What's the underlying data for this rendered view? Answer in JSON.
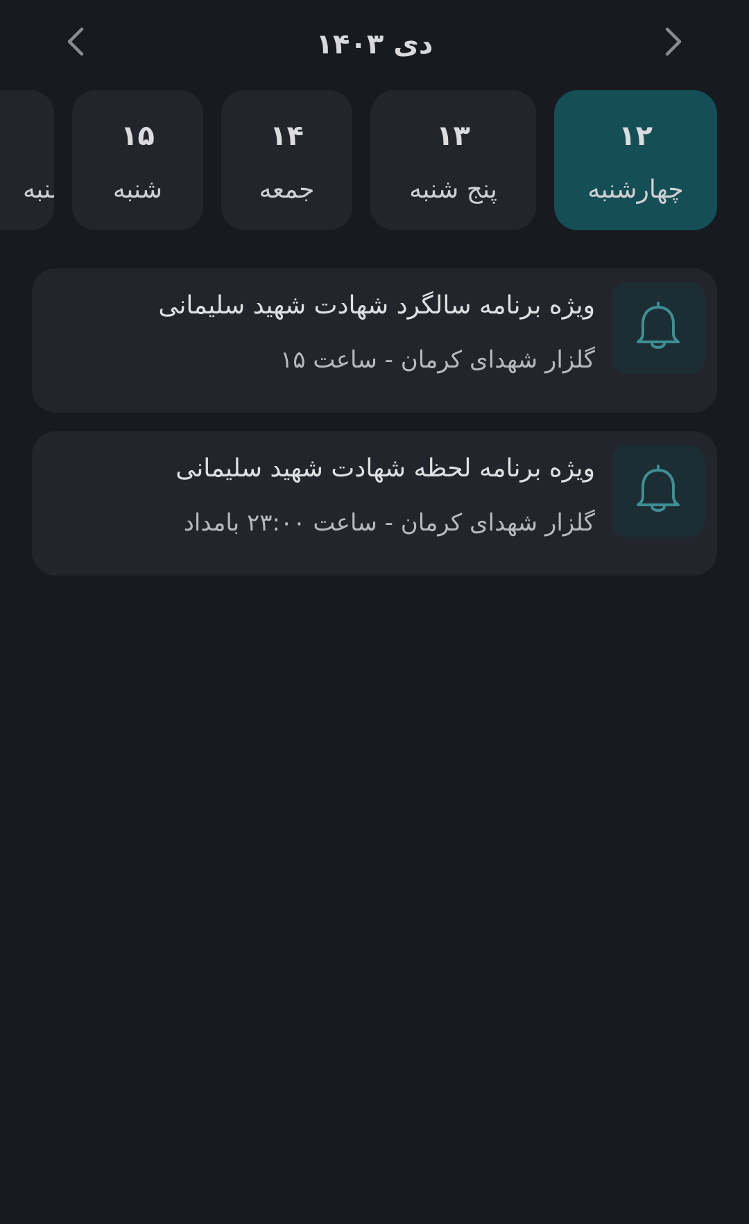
{
  "header": {
    "month_title": "دی ۱۴۰۳",
    "prev_icon": "chevron-left-icon",
    "next_icon": "chevron-right-icon"
  },
  "days": [
    {
      "number": "۱۲",
      "name": "چهارشنبه",
      "selected": true
    },
    {
      "number": "۱۳",
      "name": "پنج شنبه",
      "selected": false
    },
    {
      "number": "۱۴",
      "name": "جمعه",
      "selected": false
    },
    {
      "number": "۱۵",
      "name": "شنبه",
      "selected": false
    },
    {
      "number": "",
      "name": "یکشنبه",
      "selected": false
    }
  ],
  "events": [
    {
      "title": "ویژه برنامه سالگرد شهادت شهید سلیمانی",
      "subtitle": "گلزار شهدای کرمان - ساعت ۱۵",
      "icon": "bell-icon"
    },
    {
      "title": "ویژه برنامه لحظه شهادت شهید سلیمانی",
      "subtitle": "گلزار شهدای کرمان - ساعت  ۲۳:۰۰ بامداد",
      "icon": "bell-icon"
    }
  ],
  "colors": {
    "background": "#171a1f",
    "card": "#23252c",
    "selected_day": "#134f55",
    "icon_box": "#1c2d33",
    "icon_stroke": "#3d8f95"
  }
}
